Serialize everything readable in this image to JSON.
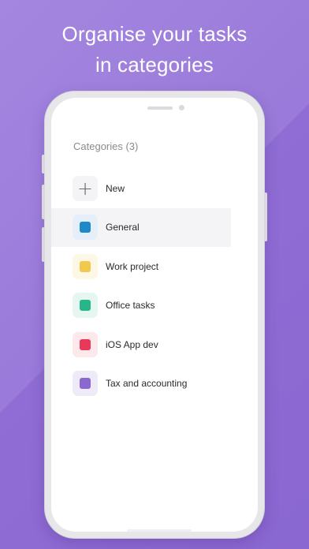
{
  "headline": {
    "line1": "Organise your tasks",
    "line2": "in categories"
  },
  "screen": {
    "title": "Categories (3)",
    "new_label": "New",
    "categories": [
      {
        "label": "General",
        "color": "#1e88c9",
        "tint": "#e5effa",
        "selected": true
      },
      {
        "label": "Work project",
        "color": "#f2c94c",
        "tint": "#fdf8e6",
        "selected": false
      },
      {
        "label": "Office tasks",
        "color": "#27b58a",
        "tint": "#e6f6f0",
        "selected": false
      },
      {
        "label": "iOS App dev",
        "color": "#e8395a",
        "tint": "#fde8ec",
        "selected": false
      },
      {
        "label": "Tax and accounting",
        "color": "#8a67d1",
        "tint": "#efeaf8",
        "selected": false
      }
    ]
  }
}
